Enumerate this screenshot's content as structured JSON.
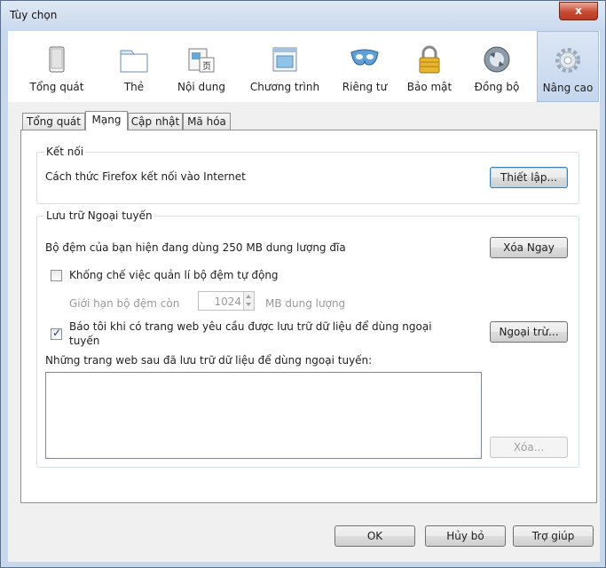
{
  "window": {
    "title": "Tùy chọn",
    "close_glyph": "x"
  },
  "toolbar": {
    "items": [
      {
        "label": "Tổng quát",
        "icon": "general-icon"
      },
      {
        "label": "Thẻ",
        "icon": "tabs-icon"
      },
      {
        "label": "Nội dung",
        "icon": "content-icon"
      },
      {
        "label": "Chương trình",
        "icon": "applications-icon"
      },
      {
        "label": "Riêng tư",
        "icon": "privacy-mask-icon"
      },
      {
        "label": "Bảo mật",
        "icon": "security-lock-icon"
      },
      {
        "label": "Đồng bộ",
        "icon": "sync-icon"
      },
      {
        "label": "Nâng cao",
        "icon": "advanced-gear-icon",
        "selected": true
      }
    ]
  },
  "tabs": [
    {
      "label": "Tổng quát"
    },
    {
      "label": "Mạng",
      "active": true
    },
    {
      "label": "Cập nhật"
    },
    {
      "label": "Mã hóa"
    }
  ],
  "connection": {
    "legend": "Kết nối",
    "description": "Cách thức Firefox kết nối vào Internet",
    "settings_label": "Thiết lập..."
  },
  "offline": {
    "legend": "Lưu trữ Ngoại tuyến",
    "cache_usage": "Bộ đệm của bạn hiện đang dùng 250 MB dung lượng đĩa",
    "clear_now_label": "Xóa Ngay",
    "override_label": "Khống chế việc quản lí bộ đệm tự động",
    "override_checked": false,
    "limit_label": "Giới hạn bộ đệm còn",
    "limit_value": "1024",
    "limit_unit": "MB dung lượng",
    "notify_label_line1": "Báo tôi khi có trang web yêu cầu được lưu trữ dữ liệu để dùng ngoại",
    "notify_label_line2": "tuyến",
    "notify_checked": true,
    "exceptions_label": "Ngoại trừ...",
    "sites_label": "Những trang web sau đã lưu trữ dữ liệu để dùng ngoại tuyến:",
    "remove_label": "Xóa..."
  },
  "footer": {
    "ok_label": "OK",
    "cancel_label": "Hủy bỏ",
    "help_label": "Trợ giúp"
  }
}
